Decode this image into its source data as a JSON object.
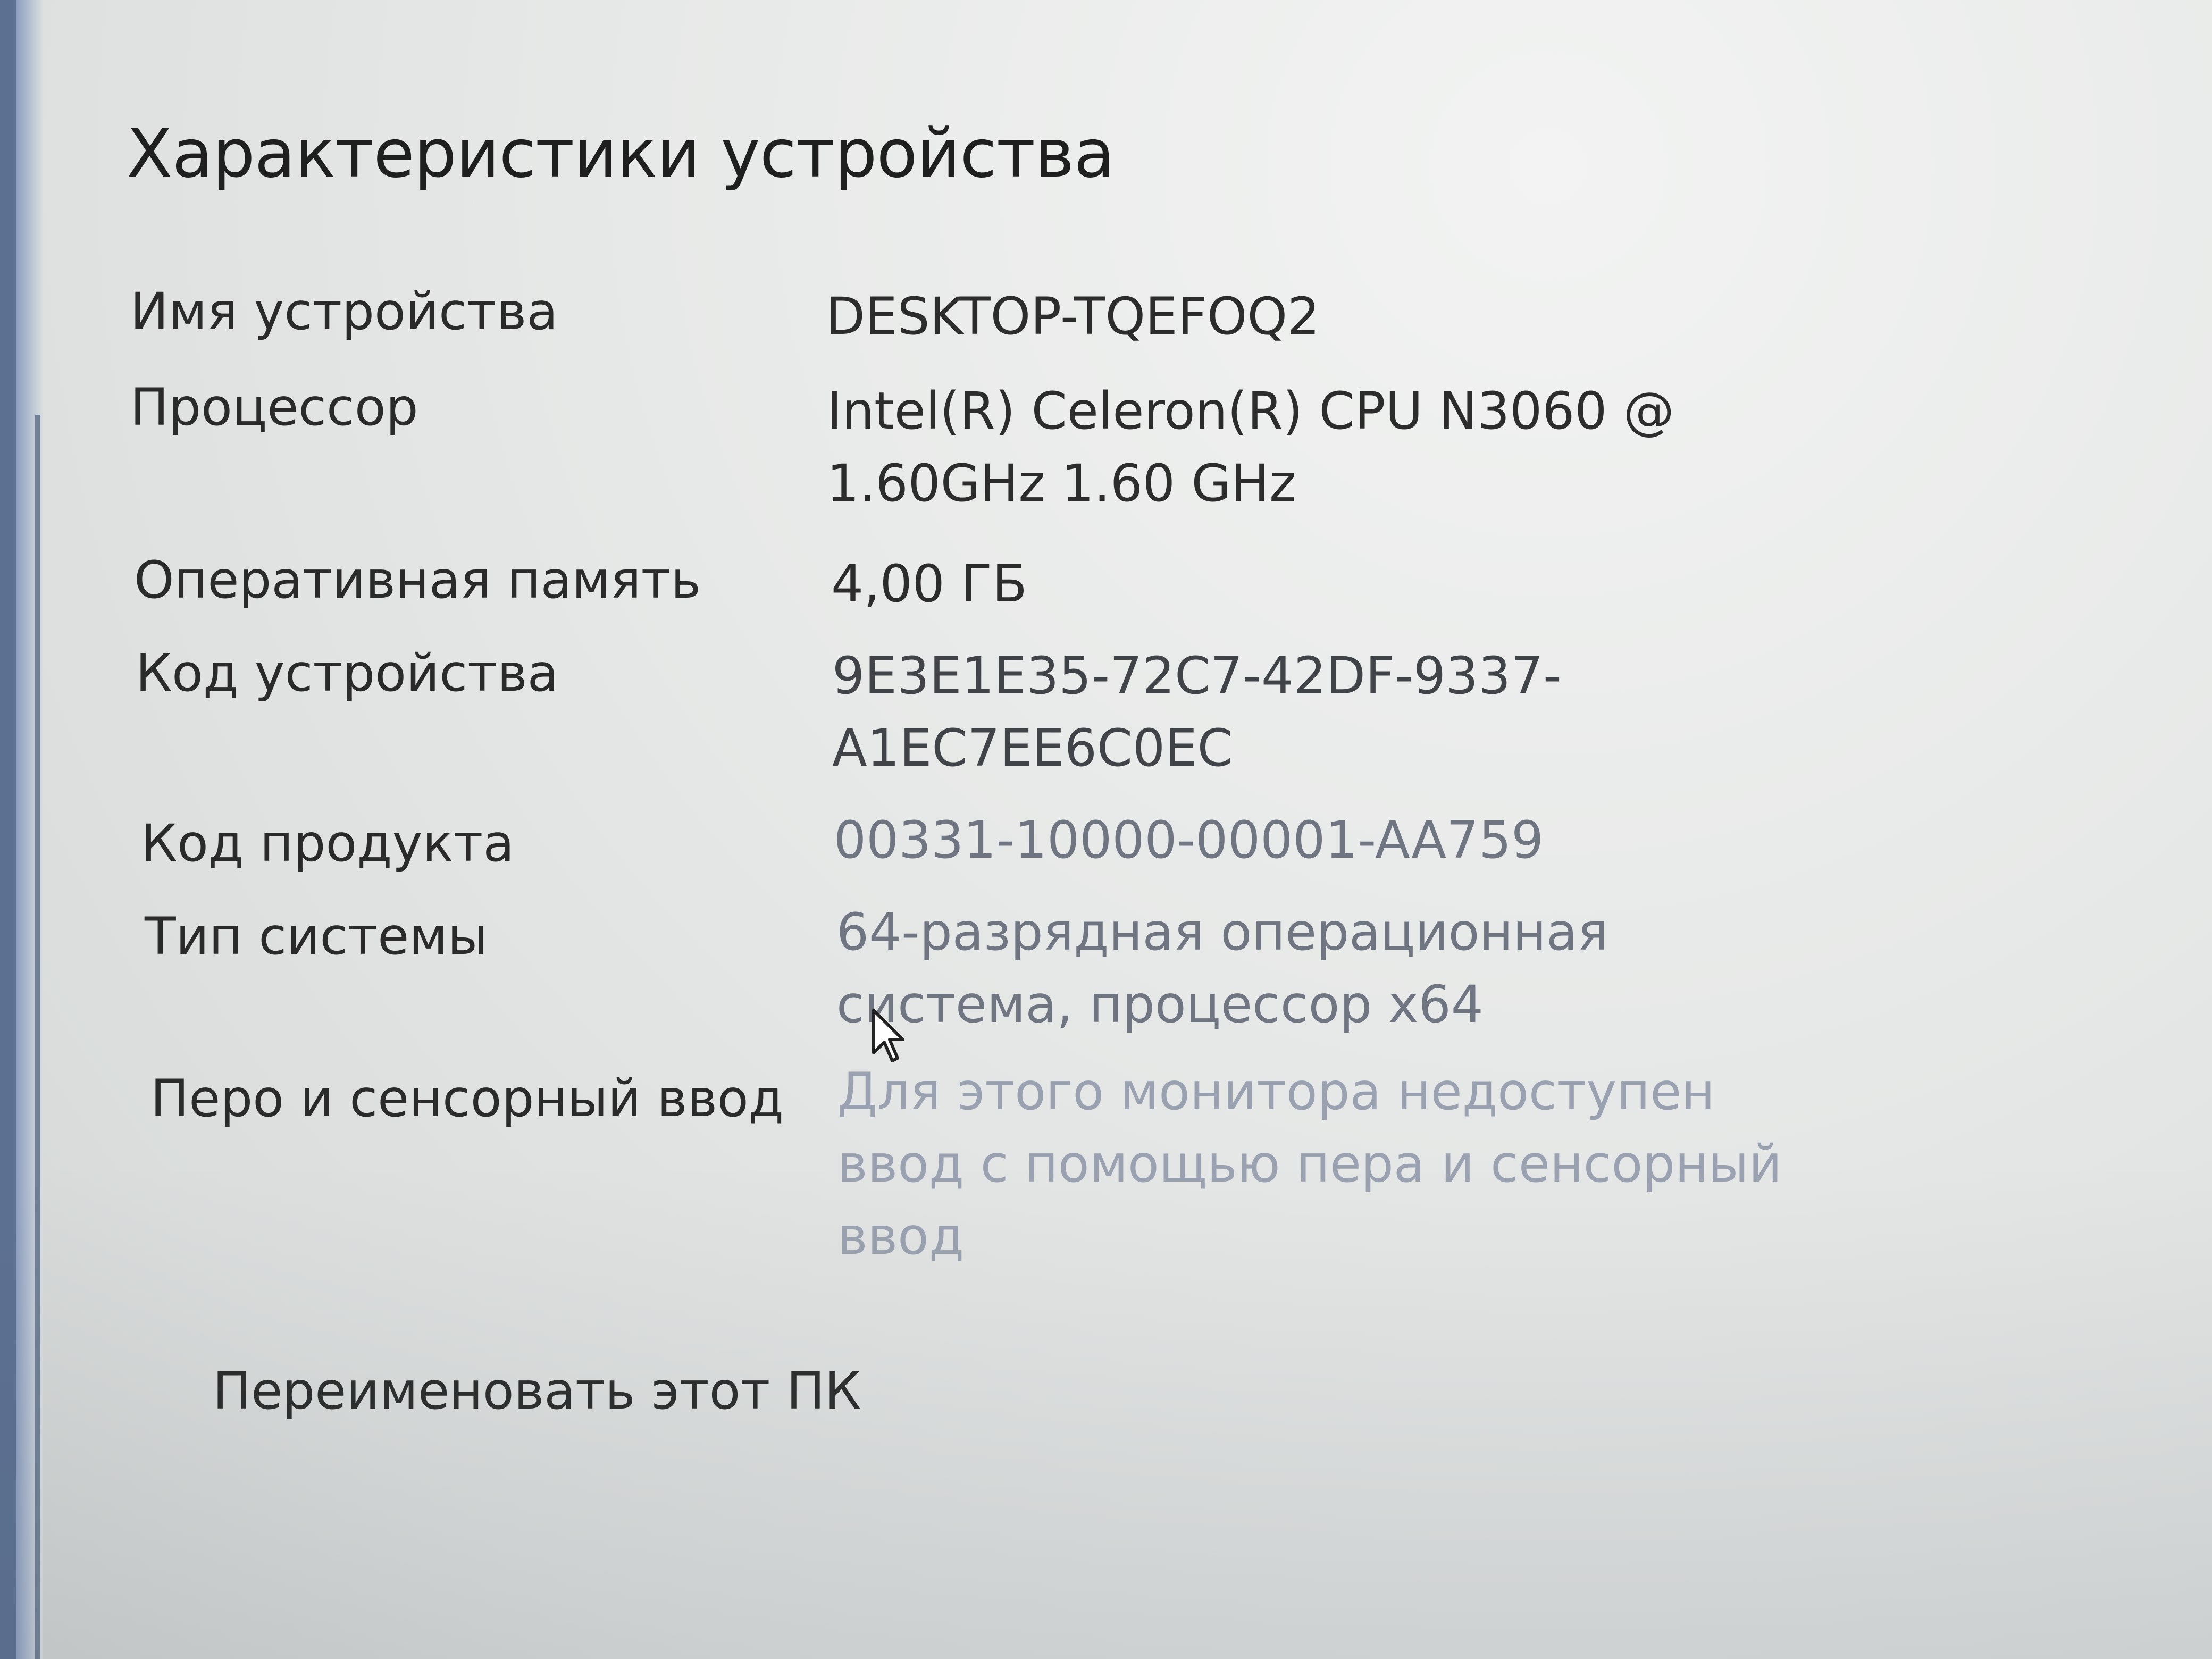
{
  "section": {
    "title": "Характеристики устройства"
  },
  "specs": [
    {
      "label": "Имя устройства",
      "value_lines": [
        "DESKTOP-TQEFOQ2"
      ]
    },
    {
      "label": "Процессор",
      "value_lines": [
        "Intel(R) Celeron(R) CPU  N3060  @",
        "1.60GHz   1.60 GHz"
      ]
    },
    {
      "label": "Оперативная память",
      "value_lines": [
        "4,00 ГБ"
      ]
    },
    {
      "label": "Код устройства",
      "value_lines": [
        "9E3E1E35-72C7-42DF-9337-",
        "A1EC7EE6C0EC"
      ]
    },
    {
      "label": "Код продукта",
      "value_lines": [
        "00331-10000-00001-AA759"
      ]
    },
    {
      "label": "Тип системы",
      "value_lines": [
        "64-разрядная операционная",
        "система, процессор x64"
      ]
    },
    {
      "label": "Перо и сенсорный ввод",
      "value_lines": [
        "Для этого монитора недоступен",
        "ввод с помощью пера и сенсорный",
        "ввод"
      ]
    }
  ],
  "actions": {
    "rename_pc": "Переименовать этот ПК"
  },
  "icons": {
    "cursor": "mouse-pointer-icon"
  }
}
